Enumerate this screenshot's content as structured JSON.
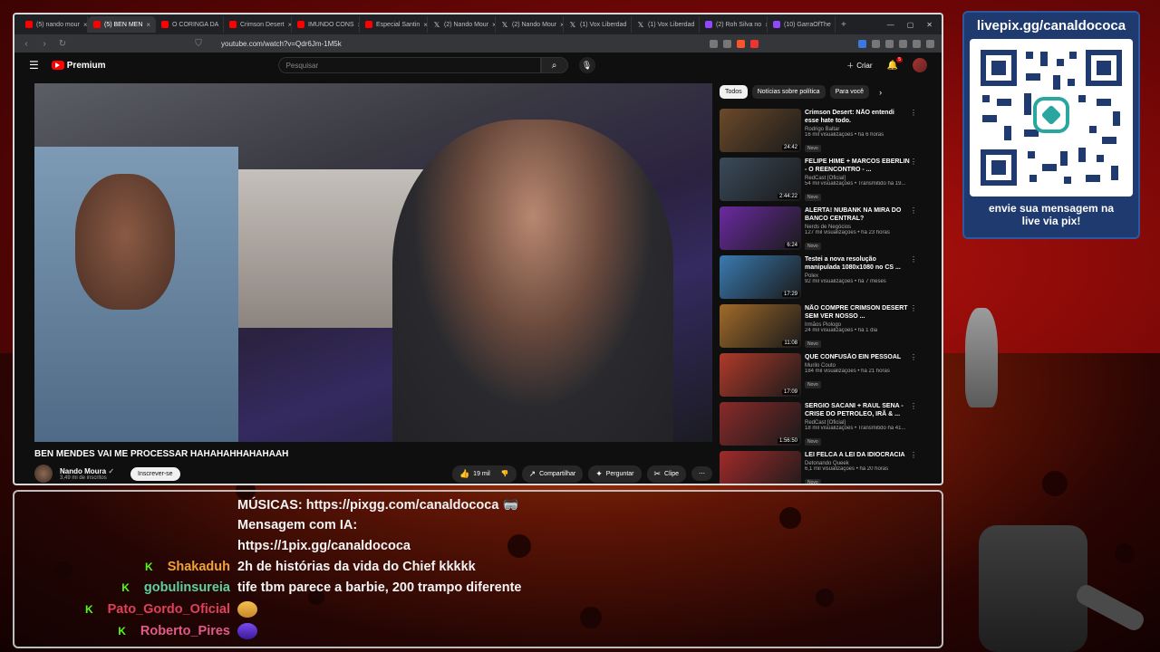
{
  "colors": {
    "yt_red": "#ff0000",
    "accent_green": "#53fc18",
    "qr_panel": "#1e3a6e"
  },
  "browser": {
    "tabs": [
      {
        "title": "(5) nando mour",
        "icon": "youtube-icon"
      },
      {
        "title": "(5) BEN MEN",
        "icon": "youtube-icon",
        "active": true
      },
      {
        "title": "O CORINGA DA",
        "icon": "youtube-icon"
      },
      {
        "title": "Crimson Desert",
        "icon": "youtube-icon"
      },
      {
        "title": "IMUNDO CONS",
        "icon": "youtube-icon"
      },
      {
        "title": "Especial Santin",
        "icon": "youtube-icon"
      },
      {
        "title": "(2) Nando Mour",
        "icon": "x-icon"
      },
      {
        "title": "(2) Nando Mour",
        "icon": "x-icon"
      },
      {
        "title": "(1) Vox Liberdad",
        "icon": "x-icon"
      },
      {
        "title": "(1) Vox Liberdad",
        "icon": "x-icon"
      },
      {
        "title": "(2) Roh Silva no",
        "icon": "twitch-icon"
      },
      {
        "title": "(10) GarraOfThe",
        "icon": "twitch-icon"
      }
    ],
    "url": "youtube.com/watch?v=Qdr6Jm-1M5k"
  },
  "youtube": {
    "logo_text": "Premium",
    "search_placeholder": "Pesquisar",
    "create_label": "Criar",
    "notif_count": "5",
    "video_title": "BEN MENDES VAI ME PROCESSAR HAHAHAHHAHAHAAH",
    "channel_name": "Nando Moura",
    "subscribers": "3,49 mi de inscritos",
    "subscribe_label": "Inscrever-se",
    "likes": "19 mil",
    "share_label": "Compartilhar",
    "ask_label": "Perguntar",
    "clip_label": "Clipe",
    "chips": [
      "Todos",
      "Notícias sobre política",
      "Para você"
    ]
  },
  "sidebar": [
    {
      "title": "Crimson Desert: NÃO entendi esse hate todo.",
      "channel": "Rodrigo Baltar",
      "views": "16 mil visualizações • há 6 horas",
      "badge": "Novo",
      "duration": "24:42",
      "thumb_color": "#6b4a2a"
    },
    {
      "title": "FELIPE HIME + MARCOS EBERLIN - O REENCONTRO - ...",
      "channel": "RedCast [Oficial]",
      "views": "54 mil visualizações • Transmitido há 19...",
      "badge": "Novo",
      "duration": "2:44:22",
      "thumb_color": "#3a4a5a"
    },
    {
      "title": "ALERTA! NUBANK NA MIRA DO BANCO CENTRAL?",
      "channel": "Nerds de Negócios",
      "views": "127 mil visualizações • há 23 horas",
      "badge": "Novo",
      "duration": "6:24",
      "thumb_color": "#6a2aa0"
    },
    {
      "title": "Testei a nova resolução manipulada 1080x1080 no CS ...",
      "channel": "Polex",
      "views": "92 mil visualizações • há 7 meses",
      "badge": "",
      "duration": "17:29",
      "thumb_color": "#3a7ab0"
    },
    {
      "title": "NÃO COMPRE CRIMSON DESERT SEM VER NOSSO ...",
      "channel": "Irmãos Piologo",
      "views": "24 mil visualizações • há 1 dia",
      "badge": "Novo",
      "duration": "11:08",
      "thumb_color": "#a06a2a"
    },
    {
      "title": "QUE CONFUSÃO EIN PESSOAL",
      "channel": "Murilo Couto",
      "views": "184 mil visualizações • há 21 horas",
      "badge": "Novo",
      "duration": "17:09",
      "thumb_color": "#b03a2a"
    },
    {
      "title": "SERGIO SACANI + RAUL SENA - CRISE DO PETROLEO, IRÃ & ...",
      "channel": "RedCast [Oficial]",
      "views": "18 mil visualizações • Transmitido há 41...",
      "badge": "Novo",
      "duration": "1:56:50",
      "thumb_color": "#8a2a2a"
    },
    {
      "title": "LEI FELCA A LEI DA IDIOCRACIA",
      "channel": "Detonando Queek",
      "views": "6,1 mil visualizações • há 20 horas",
      "badge": "Novo",
      "duration": "",
      "thumb_color": "#a02a2a"
    }
  ],
  "qr": {
    "url": "livepix.gg/canaldococa",
    "caption_line1": "envie sua mensagem na",
    "caption_line2": "live via pix!"
  },
  "chat": [
    {
      "user": "",
      "badge": "",
      "color": "#f3f3f3",
      "message": "MÚSICAS: https://pixgg.com/canaldococa 🥽"
    },
    {
      "user": "",
      "badge": "",
      "color": "#f3f3f3",
      "message": "Mensagem com IA:"
    },
    {
      "user": "",
      "badge": "",
      "color": "#f3f3f3",
      "message": "https://1pix.gg/canaldococa"
    },
    {
      "user": "Shakaduh",
      "badge": "K",
      "color": "#f0a23a",
      "message": "2h de histórias da vida do Chief kkkkk"
    },
    {
      "user": "gobulinsureia",
      "badge": "K",
      "color": "#5fd0a0",
      "message": "tife tbm parece a barbie, 200 trampo diferente"
    },
    {
      "user": "Pato_Gordo_Oficial",
      "badge": "K",
      "color": "#e0405a",
      "message": ""
    },
    {
      "user": "Roberto_Pires",
      "badge": "K",
      "color": "#e05a8a",
      "message": ""
    }
  ]
}
